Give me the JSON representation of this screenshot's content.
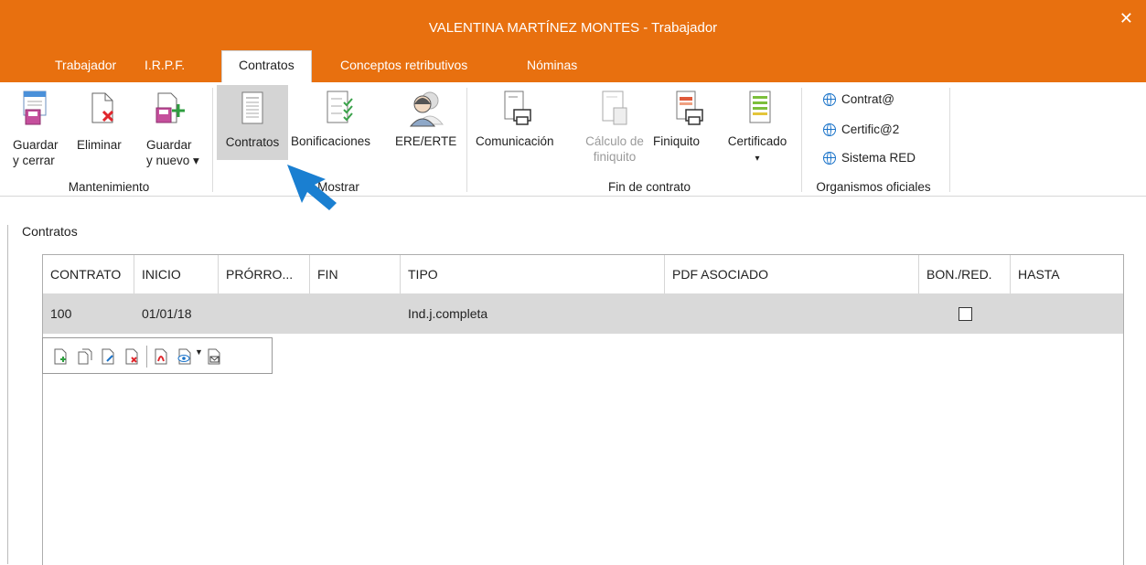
{
  "window": {
    "title": "VALENTINA MARTÍNEZ MONTES - Trabajador",
    "close_label": "✕"
  },
  "tabs": [
    {
      "label": "Trabajador"
    },
    {
      "label": "I.R.P.F."
    },
    {
      "label": "Contratos"
    },
    {
      "label": "Conceptos retributivos"
    },
    {
      "label": "Nóminas"
    }
  ],
  "ribbon": {
    "mantenimiento": {
      "label": "Mantenimiento",
      "guardar_cerrar": {
        "line1": "Guardar",
        "line2": "y cerrar"
      },
      "eliminar": {
        "line1": "Eliminar"
      },
      "guardar_nuevo": {
        "line1": "Guardar",
        "line2": "y nuevo ▾"
      }
    },
    "mostrar": {
      "label": "Mostrar",
      "contratos": "Contratos",
      "bonificaciones": "Bonificaciones",
      "ere": "ERE/ERTE"
    },
    "fin_contrato": {
      "label": "Fin de contrato",
      "comunicacion": "Comunicación",
      "calculo": {
        "line1": "Cálculo de",
        "line2": "finiquito"
      },
      "finiquito": "Finiquito",
      "certificado": {
        "line1": "Certificado",
        "line2": "▾"
      }
    },
    "organismos": {
      "label": "Organismos oficiales",
      "items": [
        "Contrat@",
        "Certific@2",
        "Sistema RED"
      ]
    }
  },
  "section": {
    "label": "Contratos"
  },
  "table": {
    "columns": [
      "CONTRATO",
      "INICIO",
      "PRÓRRO...",
      "FIN",
      "TIPO",
      "PDF ASOCIADO",
      "BON./RED.",
      "HASTA"
    ],
    "rows": [
      {
        "contrato": "100",
        "inicio": "01/01/18",
        "prorroga": "",
        "fin": "",
        "tipo": "Ind.j.completa",
        "pdf": "",
        "bon_red": false,
        "hasta": ""
      }
    ]
  },
  "colors": {
    "accent": "#e8700f",
    "selected": "#d4d4d4",
    "row_bg": "#d9d9d9",
    "pointer": "#1a7fd1"
  }
}
